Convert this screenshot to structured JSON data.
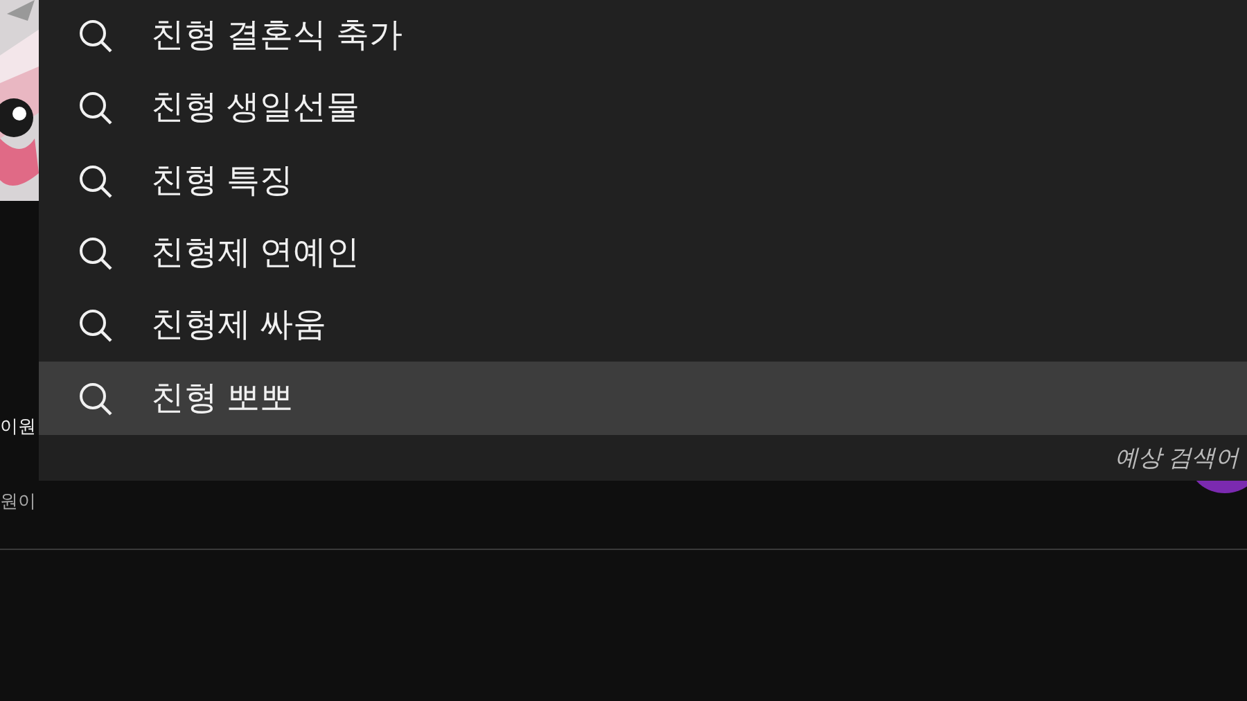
{
  "background": {
    "title": "이원",
    "meta": "원이"
  },
  "suggestions": [
    {
      "text": "친형 결혼식 축가",
      "selected": false
    },
    {
      "text": "친형 생일선물",
      "selected": false
    },
    {
      "text": "친형 특징",
      "selected": false
    },
    {
      "text": "친형제 연예인",
      "selected": false
    },
    {
      "text": "친형제 싸움",
      "selected": false
    },
    {
      "text": "친형 뽀뽀",
      "selected": true
    }
  ],
  "footer": "예상 검색어"
}
